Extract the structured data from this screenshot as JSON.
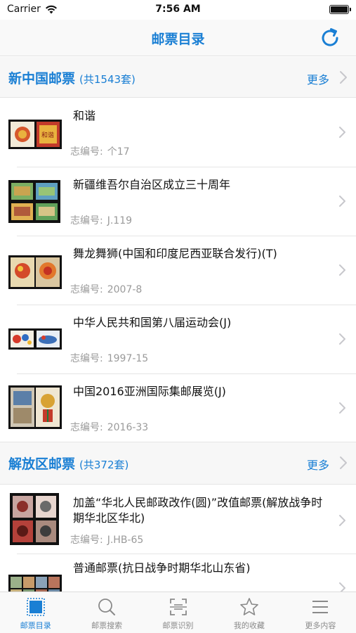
{
  "status": {
    "carrier": "Carrier",
    "time": "7:56 AM"
  },
  "nav": {
    "title": "邮票目录"
  },
  "sections": [
    {
      "title": "新中国邮票",
      "count": "(共1543套)",
      "more": "更多",
      "items": [
        {
          "title": "和谐",
          "meta_label": "志编号:",
          "meta_value": "个17"
        },
        {
          "title": "新疆维吾尔自治区成立三十周年",
          "meta_label": "志编号:",
          "meta_value": "J.119"
        },
        {
          "title": "舞龙舞狮(中国和印度尼西亚联合发行)(T)",
          "meta_label": "志编号:",
          "meta_value": "2007-8"
        },
        {
          "title": "中华人民共和国第八届运动会(J)",
          "meta_label": "志编号:",
          "meta_value": "1997-15"
        },
        {
          "title": "中国2016亚洲国际集邮展览(J)",
          "meta_label": "志编号:",
          "meta_value": "2016-33"
        }
      ]
    },
    {
      "title": "解放区邮票",
      "count": "(共372套)",
      "more": "更多",
      "items": [
        {
          "title": "加盖“华北人民邮政改作(圆)”改值邮票(解放战争时期华北区华北)",
          "meta_label": "志编号:",
          "meta_value": "J.HB-65"
        },
        {
          "title": "普通邮票(抗日战争时期华北山东省)",
          "meta_label": "",
          "meta_value": ""
        }
      ]
    }
  ],
  "tabs": [
    {
      "label": "邮票目录",
      "icon": "stamp-catalog-icon",
      "active": true
    },
    {
      "label": "邮票搜索",
      "icon": "search-icon",
      "active": false
    },
    {
      "label": "邮票识别",
      "icon": "scan-icon",
      "active": false
    },
    {
      "label": "我的收藏",
      "icon": "star-icon",
      "active": false
    },
    {
      "label": "更多内容",
      "icon": "menu-icon",
      "active": false
    }
  ],
  "colors": {
    "accent": "#1a7fd4",
    "meta": "#9a9a9a",
    "inactive_tab": "#8a8a8a"
  }
}
